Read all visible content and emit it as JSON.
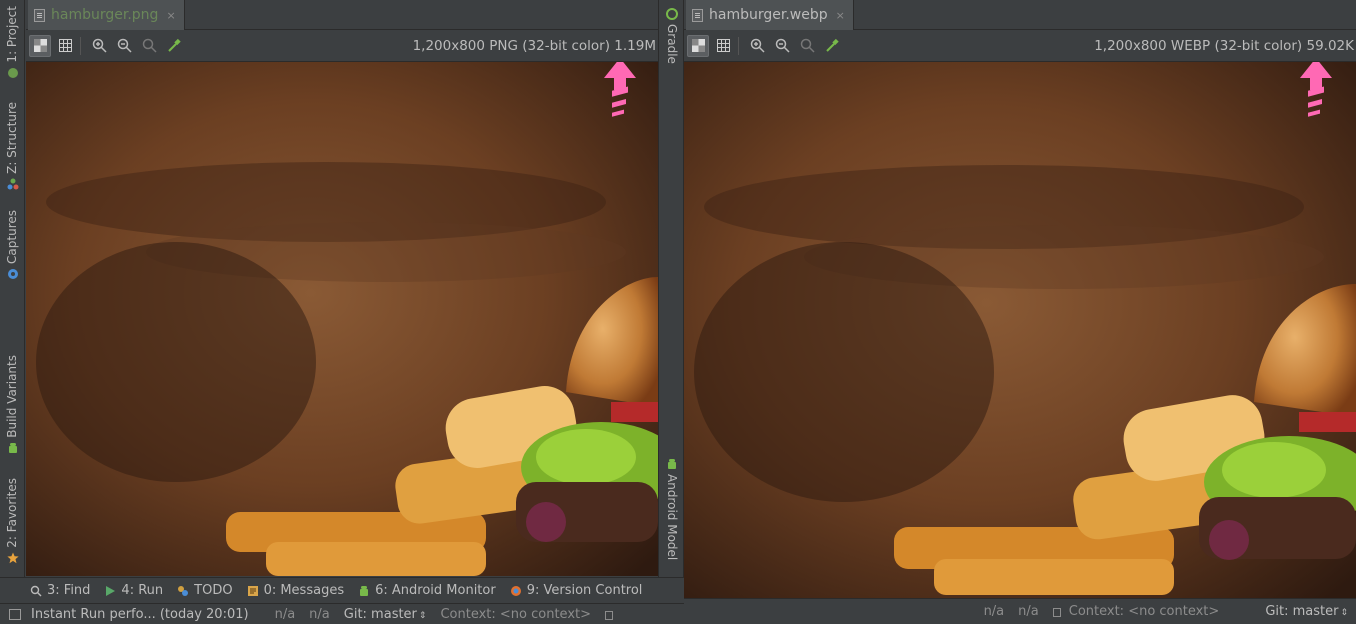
{
  "left_strip": {
    "tabs": [
      {
        "label": "1: Project",
        "icon": "project-icon"
      },
      {
        "label": "Z: Structure",
        "icon": "structure-icon"
      },
      {
        "label": "Captures",
        "icon": "captures-icon"
      },
      {
        "label": "Build Variants",
        "icon": "android-icon"
      },
      {
        "label": "2: Favorites",
        "icon": "star-icon"
      }
    ]
  },
  "middle_strip": {
    "tabs": [
      {
        "label": "Gradle",
        "icon": "gradle-icon"
      },
      {
        "label": "Android Model",
        "icon": "android-icon"
      }
    ]
  },
  "left_pane": {
    "tab_title": "hamburger.png",
    "tab_close": "×",
    "image_info": "1,200x800 PNG (32-bit color) 1.19M"
  },
  "right_pane": {
    "tab_title": "hamburger.webp",
    "tab_close": "×",
    "image_info": "1,200x800 WEBP (32-bit color) 59.02K"
  },
  "bottom_tools": [
    {
      "label": "3: Find",
      "icon": "search-icon"
    },
    {
      "label": "4: Run",
      "icon": "run-icon"
    },
    {
      "label": "TODO",
      "icon": "todo-icon"
    },
    {
      "label": "0: Messages",
      "icon": "messages-icon"
    },
    {
      "label": "6: Android Monitor",
      "icon": "android-icon"
    },
    {
      "label": "9: Version Control",
      "icon": "vcs-icon"
    }
  ],
  "status_left": {
    "message": "Instant Run perfo... (today 20:01)",
    "pos1": "n/a",
    "pos2": "n/a",
    "git": "Git: master",
    "context": "Context: <no context>"
  },
  "status_right": {
    "pos1": "n/a",
    "pos2": "n/a",
    "context": "Context: <no context>",
    "git": "Git: master"
  },
  "colors": {
    "ide_bg": "#3c3f41",
    "accent_arrow": "#ff69b4",
    "active_tab_text": "#6a8759"
  }
}
